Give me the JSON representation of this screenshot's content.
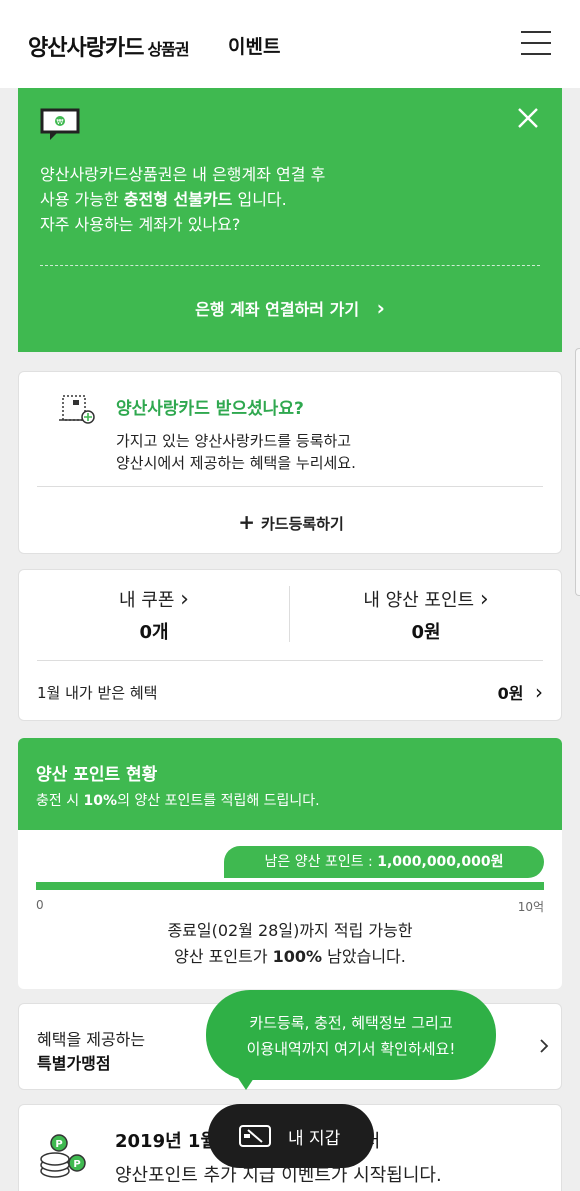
{
  "header": {
    "logo_main": "양산사랑카드",
    "logo_sub": "상품권",
    "nav_event": "이벤트"
  },
  "notice": {
    "line1": "양산사랑카드상품권은 내 은행계좌 연결 후",
    "line2_prefix": "사용 가능한 ",
    "line2_bold": "충전형 선불카드",
    "line2_suffix": " 입니다.",
    "line3": "자주 사용하는 계좌가 있나요?",
    "link_label": "은행 계좌 연결하러 가기",
    "link_chevron": "›"
  },
  "card_register": {
    "title": "양산사랑카드 받으셨나요?",
    "desc_line1": "가지고 있는 양산사랑카드를 등록하고",
    "desc_line2": "양산시에서 제공하는 혜택을 누리세요.",
    "button_plus": "+",
    "button_label": "카드등록하기"
  },
  "benefits": {
    "coupon_label": "내 쿠폰",
    "coupon_chevron": "›",
    "coupon_value": "0개",
    "point_label": "내 양산 포인트",
    "point_chevron": "›",
    "point_value": "0원",
    "month_label": "1월  내가 받은 혜택",
    "month_value": "0원",
    "month_chevron": "›"
  },
  "point_status": {
    "title": "양산 포인트 현황",
    "sub_prefix": "충전 시 ",
    "sub_bold": "10%",
    "sub_suffix": "의 양산 포인트를 적립해 드립니다.",
    "remaining_label": "남은 양산 포인트 : ",
    "remaining_value": "1,000,000,000원",
    "remaining_fraction": 1.0,
    "axis_min": "0",
    "axis_max": "10억",
    "desc_line1": "종료일(02월 28일)까지 적립 가능한",
    "desc_line2_prefix": "양산 포인트가 ",
    "desc_line2_bold": "100%",
    "desc_line2_suffix": " 남았습니다."
  },
  "store": {
    "line1": "혜택을 제공하는",
    "line2": "특별가맹점"
  },
  "tooltip": {
    "line1": "카드등록, 충전, 혜택정보 그리고",
    "line2": "이용내역까지 여기서 확인하세요!"
  },
  "event": {
    "line1_visible_left": "2019년 1월",
    "line1_visible_right": "부터",
    "line2": "양산포인트 추가 지급 이벤트가 시작됩니다."
  },
  "wallet": {
    "label": "내 지갑"
  },
  "colors": {
    "brand_green": "#3fb950",
    "dark_green": "#2fa84f",
    "wallet_bg": "#1d1d1d"
  }
}
